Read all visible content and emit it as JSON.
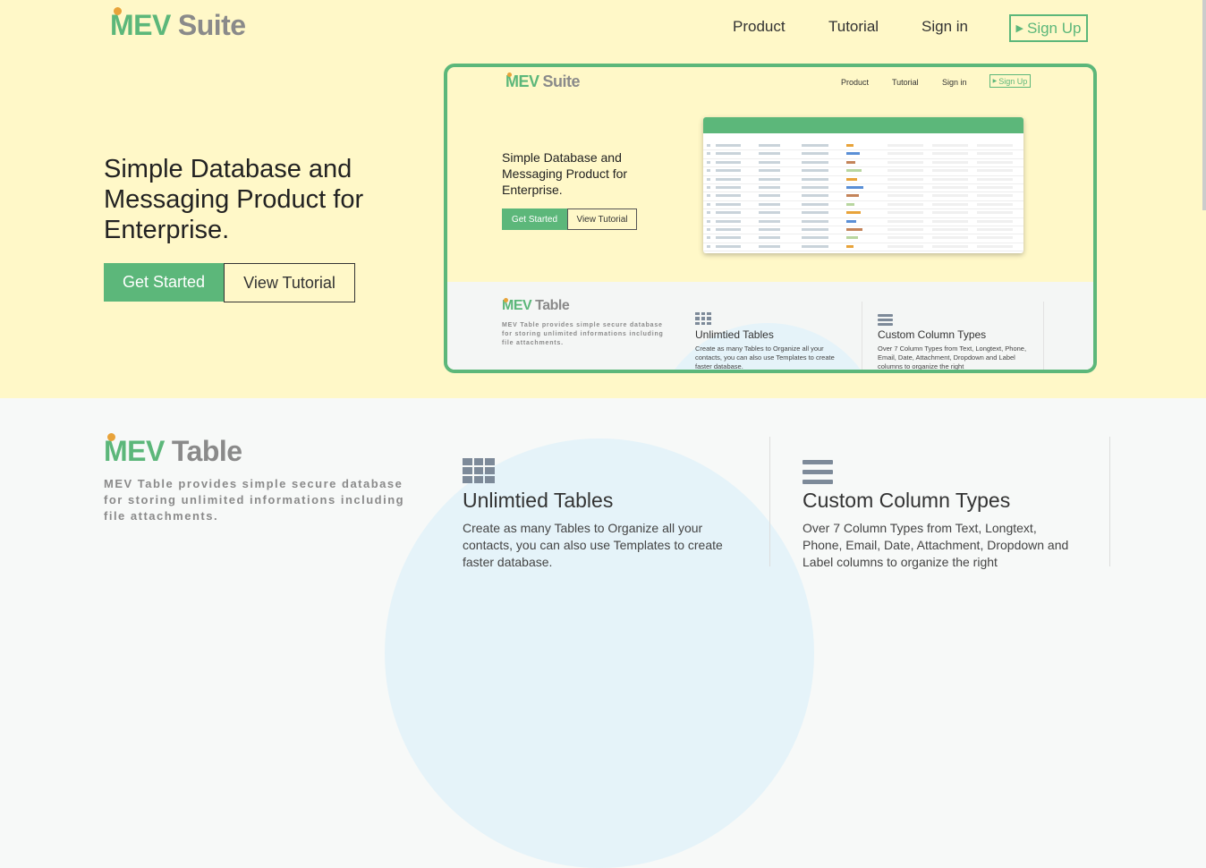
{
  "brand": {
    "mev": "MEV",
    "suite": "Suite"
  },
  "nav": {
    "product": "Product",
    "tutorial": "Tutorial",
    "signin": "Sign in",
    "signup": "Sign Up"
  },
  "hero": {
    "title": "Simple Database and Messaging Product for Enterprise.",
    "get_started": "Get Started",
    "view_tutorial": "View Tutorial"
  },
  "table_section": {
    "brand_mev": "MEV",
    "brand_table": "Table",
    "tagline": "MEV Table provides simple secure database for storing unlimited informations including file attachments.",
    "features": [
      {
        "title": "Unlimtied Tables",
        "desc": "Create as many Tables to Organize all your contacts, you can also use Templates to create faster database."
      },
      {
        "title": "Custom Column Types",
        "desc": "Over 7 Column Types from Text, Longtext, Phone, Email, Date, Attachment, Dropdown and Label columns to organize the right"
      }
    ]
  },
  "colors": {
    "accent": "#5cb77a",
    "hero_bg": "#fff8c8",
    "logo_dot": "#e8a33a",
    "gray": "#8a8a8a"
  },
  "icons": [
    "table-grid-icon",
    "column-lines-icon",
    "play-arrow-icon"
  ]
}
